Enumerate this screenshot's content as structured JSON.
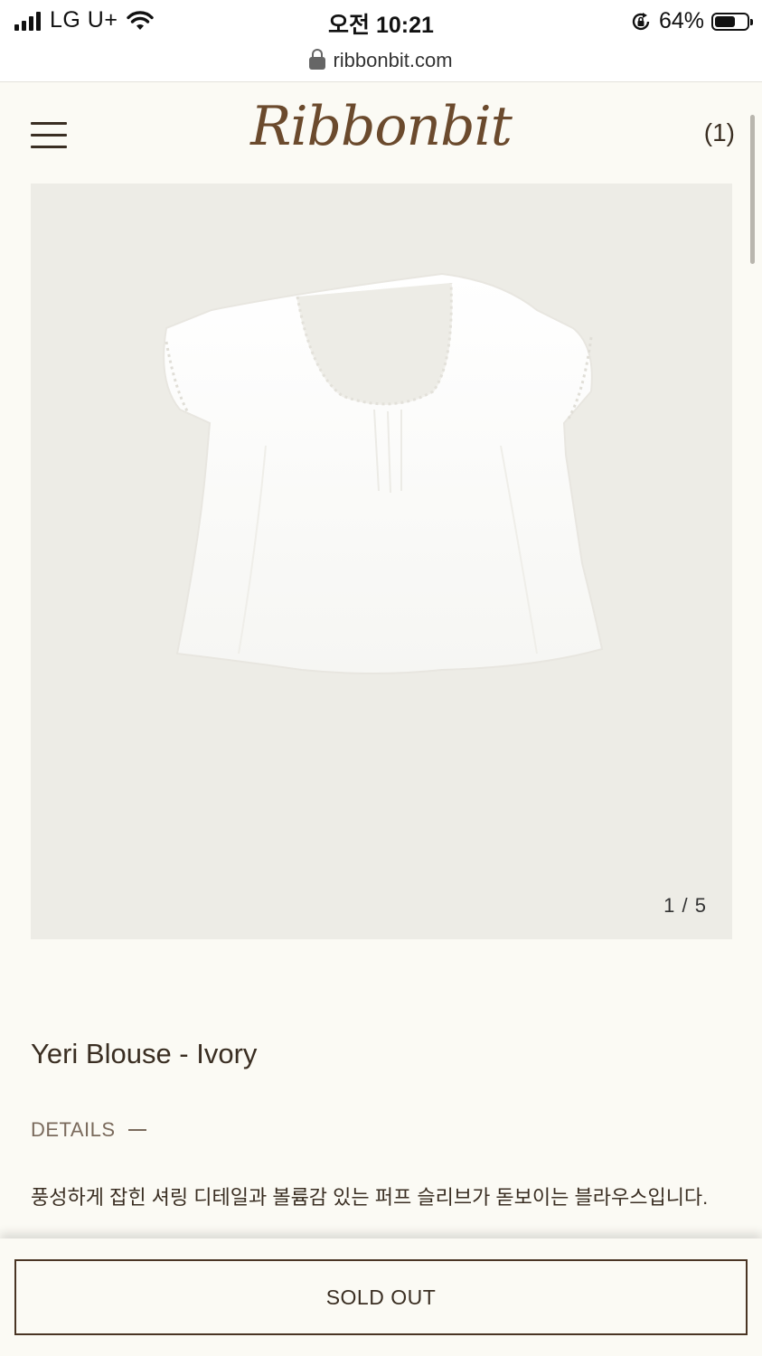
{
  "status_bar": {
    "carrier": "LG U+",
    "time": "오전 10:21",
    "battery_percent": "64%",
    "battery_level": 0.64,
    "icons": [
      "signal-icon",
      "wifi-icon",
      "rotation-lock-icon",
      "battery-icon"
    ]
  },
  "address_bar": {
    "url": "ribbonbit.com",
    "icon": "lock-icon"
  },
  "header": {
    "logo_text": "Ribbonbit",
    "cart_label": "(1)",
    "menu_icon": "hamburger-menu-icon"
  },
  "gallery": {
    "current": "1",
    "separator": "/",
    "total": "5",
    "image_subject": "white short-sleeve blouse"
  },
  "product": {
    "title": "Yeri Blouse - Ivory",
    "details_label": "DETAILS",
    "description": "풍성하게 잡힌 셔링 디테일과 볼륨감 있는 퍼프 슬리브가 돋보이는 블라우스입니다."
  },
  "actions": {
    "primary_label": "SOLD OUT"
  },
  "colors": {
    "background": "#fbfaf4",
    "image_bg": "#edece6",
    "brand": "#6b4a2d",
    "text": "#3a2e22"
  }
}
